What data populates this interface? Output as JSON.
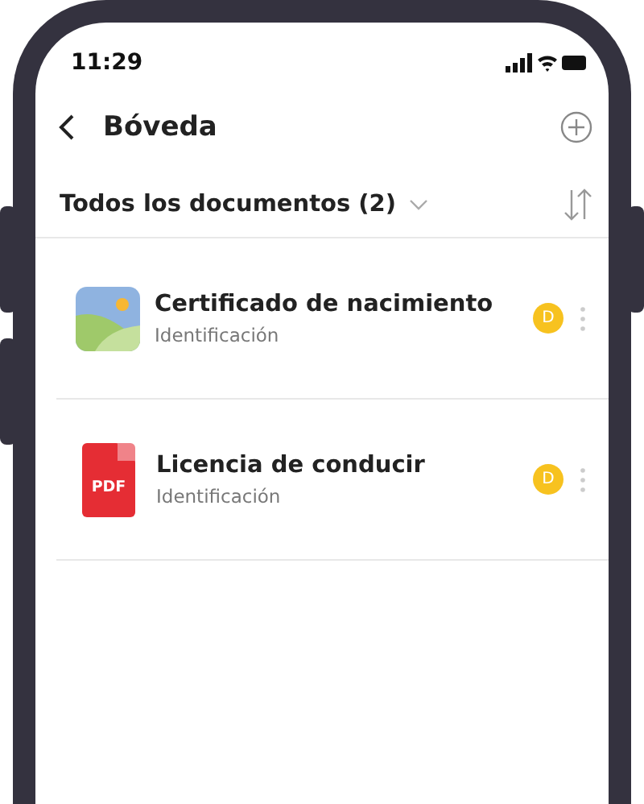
{
  "status_bar": {
    "time": "11:29"
  },
  "header": {
    "title": "Bóveda"
  },
  "filter": {
    "label": "Todos los documentos (2)"
  },
  "documents": [
    {
      "kind": "image",
      "title": "Certificado de nacimiento",
      "subtitle": "Identificación",
      "badge": "D"
    },
    {
      "kind": "pdf",
      "icon_label": "PDF",
      "title": "Licencia de conducir",
      "subtitle": "Identificación",
      "badge": "D"
    }
  ]
}
